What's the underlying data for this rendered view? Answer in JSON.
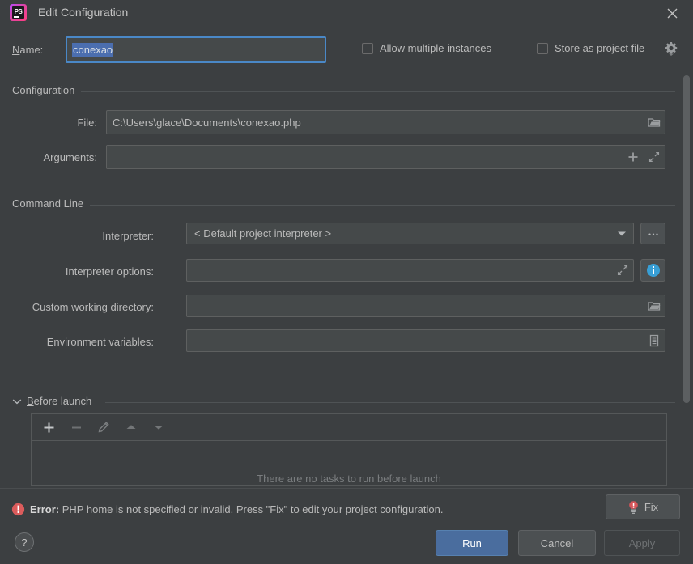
{
  "window": {
    "title": "Edit Configuration",
    "app_icon": "phpstorm-logo-icon",
    "app_icon_text": "PS",
    "close_icon": "close-icon"
  },
  "name_row": {
    "label_prefix": "N",
    "label_rest": "ame:",
    "value": "conexao",
    "allow_multiple": {
      "label_prefix": "Allow m",
      "label_mnemonic": "u",
      "label_rest": "ltiple instances",
      "checked": false
    },
    "store_project": {
      "label_prefix": "",
      "label_mnemonic": "S",
      "label_rest": "tore as project file",
      "checked": false
    },
    "gear_icon": "gear-dropdown-icon"
  },
  "configuration": {
    "title": "Configuration",
    "file": {
      "label": "File:",
      "value": "C:\\Users\\glace\\Documents\\conexao.php",
      "button_icon": "folder-icon"
    },
    "arguments": {
      "label": "Arguments:",
      "value": "",
      "add_icon": "plus-icon",
      "expand_icon": "expand-icon"
    }
  },
  "command_line": {
    "title": "Command Line",
    "interpreter": {
      "label": "Interpreter:",
      "value": "< Default project interpreter >",
      "arrow_icon": "chevron-down-icon",
      "more_label": "...",
      "more_icon": "ellipsis-icon"
    },
    "interpreter_options": {
      "label": "Interpreter options:",
      "value": "",
      "expand_icon": "expand-icon",
      "info_icon": "info-icon"
    },
    "working_directory": {
      "label": "Custom working directory:",
      "value": "",
      "button_icon": "folder-icon"
    },
    "environment_variables": {
      "label": "Environment variables:",
      "value": "",
      "button_icon": "list-icon"
    }
  },
  "before_launch": {
    "title_mnemonic": "B",
    "title_rest": "efore launch",
    "expanded": true,
    "chevron_icon": "chevron-down-icon",
    "toolbar": [
      {
        "name": "add-task-button",
        "icon": "plus-icon",
        "enabled": true
      },
      {
        "name": "remove-task-button",
        "icon": "minus-icon",
        "enabled": false
      },
      {
        "name": "edit-task-button",
        "icon": "pencil-icon",
        "enabled": false
      },
      {
        "name": "move-up-button",
        "icon": "arrow-up-icon",
        "enabled": false
      },
      {
        "name": "move-down-button",
        "icon": "arrow-down-icon",
        "enabled": false
      }
    ],
    "empty_text": "There are no tasks to run before launch"
  },
  "error_bar": {
    "icon": "error-icon",
    "prefix": "Error:",
    "message": "PHP home is not specified or invalid. Press \"Fix\" to edit your project configuration.",
    "fix_label": "Fix",
    "fix_icon": "lightbulb-error-icon"
  },
  "footer": {
    "help_label": "?",
    "run_label": "Run",
    "cancel_label": "Cancel",
    "apply_label": "Apply",
    "apply_enabled": false
  },
  "colors": {
    "background": "#3c3f41",
    "field_background": "#45494a",
    "focus_border": "#4a88c7",
    "selection": "#4b6eaf",
    "primary_button": "#4a6d9e",
    "error": "#e05252",
    "info": "#389fd6",
    "text": "#bbbbbb"
  }
}
